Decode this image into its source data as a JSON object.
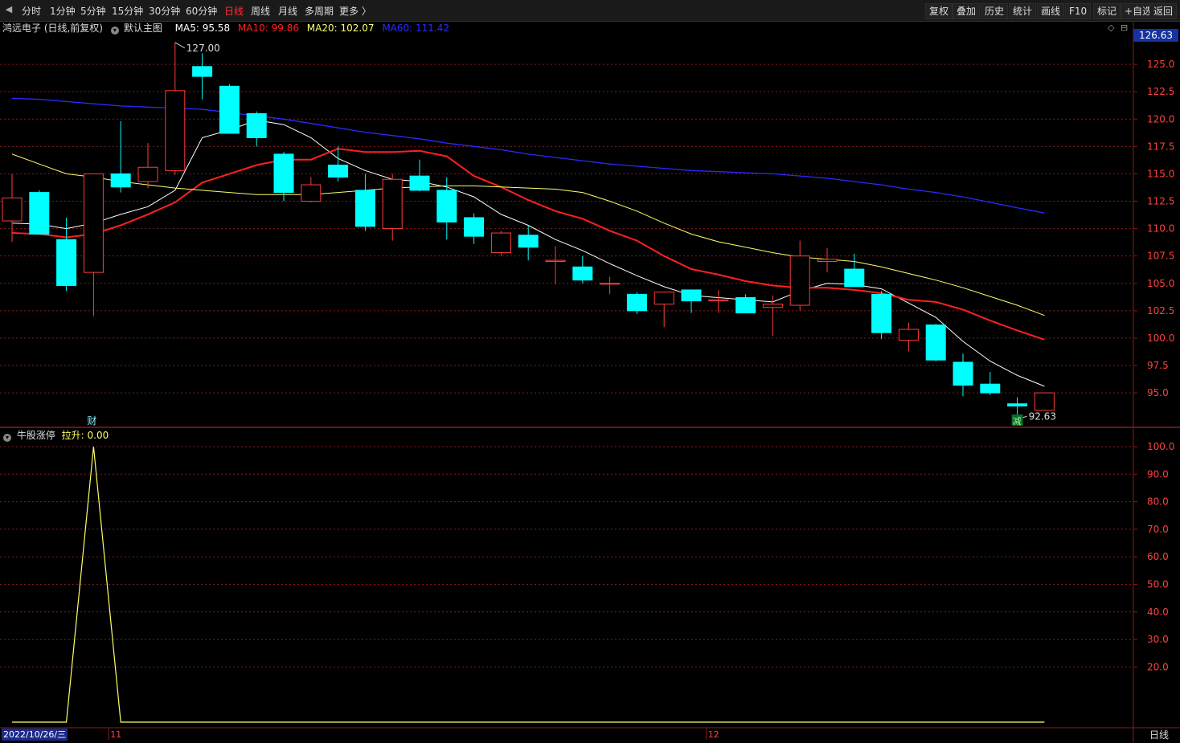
{
  "toolbar": {
    "periods": [
      "分时",
      "1分钟",
      "5分钟",
      "15分钟",
      "30分钟",
      "60分钟",
      "日线",
      "周线",
      "月线",
      "多周期",
      "更多 〉"
    ],
    "active_period": "日线",
    "right_buttons": [
      "复权",
      "叠加",
      "历史",
      "统计",
      "画线",
      "F10",
      "标记",
      "+自选",
      "返回"
    ]
  },
  "main_info": {
    "stock": "鸿远电子 (日线,前复权)",
    "template": "默认主图",
    "ma5_label": "MA5: 95.58",
    "ma10_label": "MA10: 99.86",
    "ma20_label": "MA20: 102.07",
    "ma60_label": "MA60: 111.42"
  },
  "sub_info": {
    "indicator": "牛股涨停",
    "value_label": "拉升: 0.00"
  },
  "current_price_flag": "126.63",
  "date_label": "2022/10/26/三",
  "period_label": "日线",
  "colors": {
    "up": "#ff3c3c",
    "down": "#00ffff",
    "ma5": "#ffffff",
    "ma10": "#ff2020",
    "ma20": "#ffff66",
    "ma60": "#2a2aff",
    "indicator_line": "#ffff66",
    "grid": "#8b1a1a"
  },
  "chart_data": [
    {
      "type": "candlestick",
      "title": "鸿远电子 (日线,前复权)",
      "ylim": [
        92.0,
        127.5
      ],
      "yticks": [
        95.0,
        97.5,
        100.0,
        102.5,
        105.0,
        107.5,
        110.0,
        112.5,
        115.0,
        117.5,
        120.0,
        122.5,
        125.0
      ],
      "x_markers": [
        {
          "index": 4,
          "label": "11"
        },
        {
          "index": 26,
          "label": "12"
        }
      ],
      "annotations": [
        {
          "text": "127.00",
          "candle": 6,
          "price": 127.0
        },
        {
          "text": "92.63",
          "candle": 37,
          "price": 92.63
        },
        {
          "text": "财",
          "candle": 3
        },
        {
          "text": "减",
          "candle": 37
        }
      ],
      "candles": [
        {
          "o": 110.7,
          "h": 115.0,
          "l": 108.8,
          "c": 112.8
        },
        {
          "o": 113.3,
          "h": 113.5,
          "l": 109.6,
          "c": 109.5
        },
        {
          "o": 109.0,
          "h": 111.0,
          "l": 104.3,
          "c": 104.8
        },
        {
          "o": 106.0,
          "h": 115.0,
          "l": 102.0,
          "c": 115.0
        },
        {
          "o": 115.0,
          "h": 119.8,
          "l": 113.3,
          "c": 113.8
        },
        {
          "o": 114.3,
          "h": 117.8,
          "l": 113.7,
          "c": 115.6
        },
        {
          "o": 115.3,
          "h": 127.0,
          "l": 114.9,
          "c": 122.6
        },
        {
          "o": 124.8,
          "h": 126.0,
          "l": 121.8,
          "c": 123.9
        },
        {
          "o": 123.0,
          "h": 123.2,
          "l": 119.4,
          "c": 118.7
        },
        {
          "o": 120.5,
          "h": 120.7,
          "l": 117.5,
          "c": 118.3
        },
        {
          "o": 116.8,
          "h": 117.0,
          "l": 112.5,
          "c": 113.3
        },
        {
          "o": 112.5,
          "h": 114.7,
          "l": 112.4,
          "c": 114.0
        },
        {
          "o": 115.8,
          "h": 117.5,
          "l": 114.3,
          "c": 114.7
        },
        {
          "o": 113.5,
          "h": 115.0,
          "l": 109.8,
          "c": 110.2
        },
        {
          "o": 110.0,
          "h": 115.0,
          "l": 108.9,
          "c": 114.5
        },
        {
          "o": 114.8,
          "h": 116.3,
          "l": 113.4,
          "c": 113.5
        },
        {
          "o": 113.5,
          "h": 114.7,
          "l": 109.0,
          "c": 110.6
        },
        {
          "o": 111.0,
          "h": 111.4,
          "l": 108.6,
          "c": 109.3
        },
        {
          "o": 107.8,
          "h": 109.8,
          "l": 107.5,
          "c": 109.6
        },
        {
          "o": 109.4,
          "h": 110.3,
          "l": 107.1,
          "c": 108.3
        },
        {
          "o": 107.0,
          "h": 108.4,
          "l": 104.9,
          "c": 107.1
        },
        {
          "o": 106.5,
          "h": 107.5,
          "l": 105.0,
          "c": 105.3
        },
        {
          "o": 105.0,
          "h": 105.6,
          "l": 104.0,
          "c": 105.0
        },
        {
          "o": 104.0,
          "h": 104.2,
          "l": 102.2,
          "c": 102.5
        },
        {
          "o": 103.1,
          "h": 104.2,
          "l": 101.0,
          "c": 104.2
        },
        {
          "o": 104.4,
          "h": 104.4,
          "l": 102.3,
          "c": 103.4
        },
        {
          "o": 103.4,
          "h": 104.4,
          "l": 102.3,
          "c": 103.5
        },
        {
          "o": 103.7,
          "h": 104.0,
          "l": 102.4,
          "c": 102.3
        },
        {
          "o": 102.8,
          "h": 103.9,
          "l": 100.2,
          "c": 103.1
        },
        {
          "o": 103.0,
          "h": 108.9,
          "l": 102.5,
          "c": 107.5
        },
        {
          "o": 107.0,
          "h": 108.2,
          "l": 106.0,
          "c": 107.2
        },
        {
          "o": 106.3,
          "h": 107.7,
          "l": 104.8,
          "c": 104.7
        },
        {
          "o": 104.0,
          "h": 104.3,
          "l": 99.9,
          "c": 100.5
        },
        {
          "o": 99.8,
          "h": 101.4,
          "l": 98.8,
          "c": 100.8
        },
        {
          "o": 101.2,
          "h": 101.3,
          "l": 97.9,
          "c": 98.0
        },
        {
          "o": 97.8,
          "h": 98.6,
          "l": 94.7,
          "c": 95.7
        },
        {
          "o": 95.8,
          "h": 96.9,
          "l": 94.8,
          "c": 95.0
        },
        {
          "o": 94.0,
          "h": 94.6,
          "l": 92.63,
          "c": 93.8
        },
        {
          "o": 93.4,
          "h": 95.0,
          "l": 93.4,
          "c": 95.0
        }
      ],
      "series": [
        {
          "name": "MA5",
          "values": [
            110.5,
            110.4,
            110.0,
            110.5,
            111.3,
            112.0,
            113.5,
            118.3,
            119.0,
            119.9,
            119.5,
            118.3,
            116.4,
            115.3,
            114.5,
            114.3,
            113.8,
            112.9,
            111.3,
            110.3,
            109.0,
            108.0,
            106.8,
            105.7,
            104.7,
            103.9,
            103.7,
            103.5,
            103.3,
            104.3,
            105.0,
            104.9,
            104.5,
            103.2,
            101.9,
            99.7,
            97.9,
            96.6,
            95.6
          ]
        },
        {
          "name": "MA10",
          "values": [
            109.6,
            109.5,
            109.2,
            109.5,
            110.3,
            111.3,
            112.4,
            114.2,
            115.0,
            115.8,
            116.3,
            116.3,
            117.3,
            117.0,
            117.0,
            117.1,
            116.6,
            114.8,
            113.8,
            112.6,
            111.6,
            110.9,
            109.8,
            108.9,
            107.5,
            106.3,
            105.8,
            105.2,
            104.8,
            104.6,
            104.6,
            104.4,
            104.1,
            103.5,
            103.3,
            102.6,
            101.6,
            100.7,
            99.86
          ]
        },
        {
          "name": "MA20",
          "values": [
            116.8,
            115.9,
            115.0,
            114.7,
            114.3,
            114.0,
            113.7,
            113.5,
            113.3,
            113.1,
            113.1,
            113.1,
            113.3,
            113.5,
            113.7,
            113.8,
            113.9,
            113.9,
            113.8,
            113.7,
            113.6,
            113.3,
            112.5,
            111.6,
            110.5,
            109.5,
            108.8,
            108.3,
            107.8,
            107.4,
            107.2,
            107.0,
            106.5,
            105.9,
            105.3,
            104.6,
            103.8,
            103.0,
            102.07
          ]
        },
        {
          "name": "MA60",
          "values": [
            121.9,
            121.8,
            121.6,
            121.4,
            121.2,
            121.1,
            121.0,
            120.9,
            120.6,
            120.3,
            120.0,
            119.6,
            119.2,
            118.8,
            118.5,
            118.2,
            117.8,
            117.5,
            117.2,
            116.8,
            116.5,
            116.2,
            115.9,
            115.7,
            115.5,
            115.3,
            115.2,
            115.1,
            115.0,
            114.8,
            114.6,
            114.3,
            114.0,
            113.6,
            113.3,
            112.9,
            112.4,
            111.9,
            111.42
          ]
        }
      ]
    },
    {
      "type": "line",
      "title": "牛股涨停",
      "ylim": [
        0,
        100
      ],
      "yticks": [
        20.0,
        30.0,
        40.0,
        50.0,
        60.0,
        70.0,
        80.0,
        90.0,
        100.0
      ],
      "series": [
        {
          "name": "拉升",
          "values": [
            0,
            0,
            0,
            100,
            0,
            0,
            0,
            0,
            0,
            0,
            0,
            0,
            0,
            0,
            0,
            0,
            0,
            0,
            0,
            0,
            0,
            0,
            0,
            0,
            0,
            0,
            0,
            0,
            0,
            0,
            0,
            0,
            0,
            0,
            0,
            0,
            0,
            0,
            0
          ]
        }
      ]
    }
  ]
}
